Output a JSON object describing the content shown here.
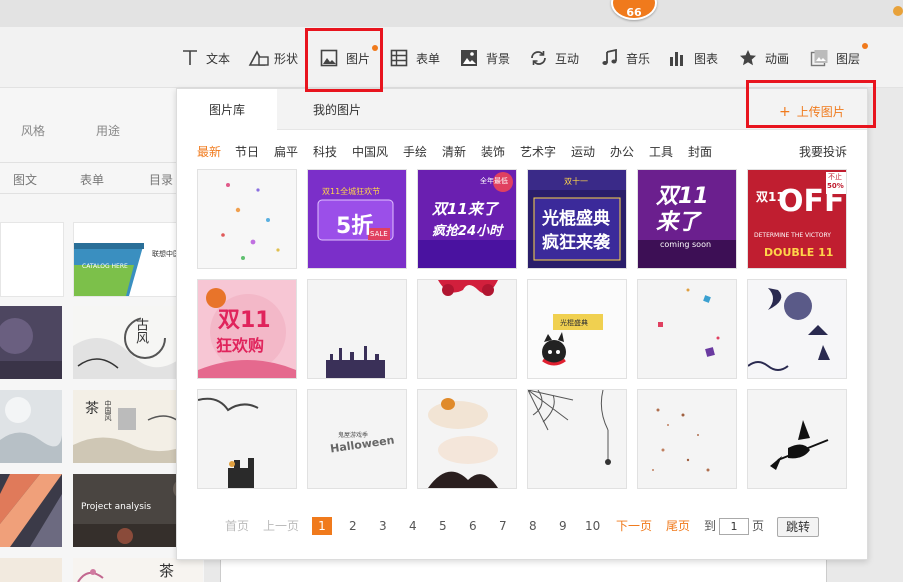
{
  "notification_count": "66",
  "toolbar": {
    "items": [
      {
        "label": "文本",
        "icon": "text-icon"
      },
      {
        "label": "形状",
        "icon": "shape-icon"
      },
      {
        "label": "图片",
        "icon": "image-icon"
      },
      {
        "label": "表单",
        "icon": "form-icon"
      },
      {
        "label": "背景",
        "icon": "background-icon"
      },
      {
        "label": "互动",
        "icon": "interaction-icon"
      },
      {
        "label": "音乐",
        "icon": "music-icon"
      },
      {
        "label": "图表",
        "icon": "chart-icon"
      },
      {
        "label": "动画",
        "icon": "star-icon"
      },
      {
        "label": "图层",
        "icon": "layer-icon"
      }
    ]
  },
  "left_panel": {
    "tabs": [
      "风格",
      "用途"
    ],
    "subtabs": [
      "图文",
      "表单",
      "目录"
    ],
    "thumb_texts": {
      "catalog": "CATALOG HERE",
      "chinese_cn": "联想中国市场",
      "gufeng": "古风",
      "cha": "茶",
      "zhongguofeng": "中国风",
      "project": "Project analysis",
      "cha2": "茶"
    }
  },
  "popup": {
    "tabs": [
      "图片库",
      "我的图片"
    ],
    "upload_label": "上传图片",
    "categories": [
      "最新",
      "节日",
      "扁平",
      "科技",
      "中国风",
      "手绘",
      "清新",
      "装饰",
      "艺术字",
      "运动",
      "办公",
      "工具",
      "封面"
    ],
    "active_category": "最新",
    "contribute_label": "我要投诉",
    "images": {
      "row1": [
        {
          "name": "confetti-dots"
        },
        {
          "name": "double11-sale",
          "text_top": "双11全城狂欢节",
          "text_main": "5折",
          "text_small": "SALE"
        },
        {
          "name": "double11-coming-grab",
          "text_top": "全年最低",
          "text_main": "双11来了",
          "text_sub": "疯抢24小时"
        },
        {
          "name": "double11-celebration",
          "text_top": "双十一",
          "text_main": "光棍盛典",
          "text_sub": "疯狂来袭"
        },
        {
          "name": "double11-coming-soon",
          "text_main": "双11来了",
          "text_sub": "coming soon"
        },
        {
          "name": "double11-off",
          "text_main": "双11",
          "text_off": "OFF",
          "text_pct": "50%",
          "text_limit": "不止",
          "text_sub": "DETERMINE THE VICTORY",
          "text_bottom": "DOUBLE 11"
        }
      ],
      "row2": [
        {
          "name": "double11-carnival",
          "text_main": "双11",
          "text_sub": "狂欢购"
        },
        {
          "name": "castle-silhouette"
        },
        {
          "name": "red-ribbon"
        },
        {
          "name": "cat-double11",
          "text_main": "光棍盛典"
        },
        {
          "name": "scattered-gifts"
        },
        {
          "name": "halloween-moon"
        }
      ],
      "row3": [
        {
          "name": "halloween-tree"
        },
        {
          "name": "halloween-text",
          "text_main": "Halloween",
          "text_top": "鬼屋游戏季"
        },
        {
          "name": "pumpkin-clouds"
        },
        {
          "name": "spider-web"
        },
        {
          "name": "splatter"
        },
        {
          "name": "witch-broom"
        }
      ]
    },
    "pager": {
      "first": "首页",
      "prev": "上一页",
      "pages": [
        "1",
        "2",
        "3",
        "4",
        "5",
        "6",
        "7",
        "8",
        "9",
        "10"
      ],
      "current": "1",
      "next": "下一页",
      "last": "尾页",
      "goto_label": "到",
      "goto_value": "1",
      "page_suffix": "页",
      "jump": "跳转"
    }
  },
  "colors": {
    "accent": "#f07a1c",
    "highlight_box": "#e8141e"
  }
}
